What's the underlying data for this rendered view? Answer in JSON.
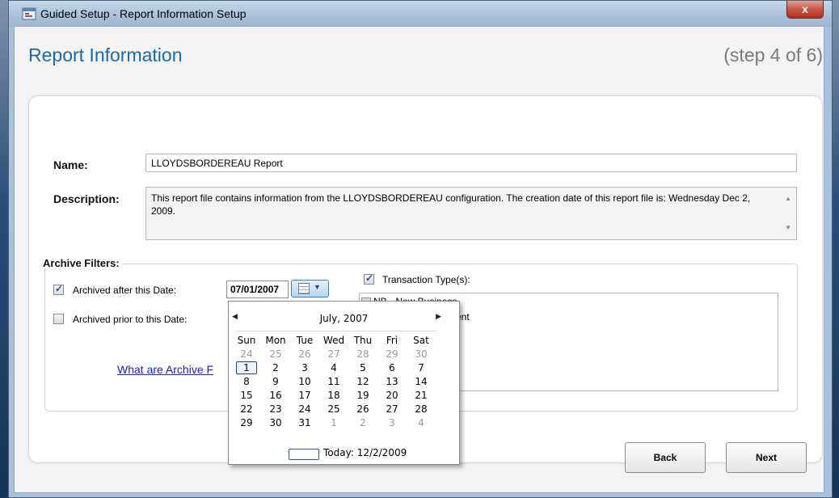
{
  "window": {
    "title": "Guided Setup - Report Information Setup",
    "close_label": "x"
  },
  "header": {
    "title": "Report Information",
    "step": "(step 4 of 6)"
  },
  "form": {
    "name_label": "Name:",
    "name_value": "LLOYDSBORDEREAU Report",
    "description_label": "Description:",
    "description_value": "This report file contains information from the LLOYDSBORDEREAU configuration.  The creation date of this report file is: Wednesday Dec 2, 2009."
  },
  "archive": {
    "section_label": "Archive Filters:",
    "after_label": "Archived after this Date:",
    "after_checked": true,
    "after_date": "07/01/2007",
    "prior_label": "Archived prior to this Date:",
    "prior_checked": false,
    "transaction_label": "Transaction Type(s):",
    "transaction_checked": true,
    "transaction_item1": "NB - New Business",
    "transaction_item2": "ent",
    "help_link": "What are Archive F"
  },
  "calendar": {
    "month": "July, 2007",
    "weekdays": [
      "Sun",
      "Mon",
      "Tue",
      "Wed",
      "Thu",
      "Fri",
      "Sat"
    ],
    "weeks": [
      [
        "24",
        "25",
        "26",
        "27",
        "28",
        "29",
        "30"
      ],
      [
        "1",
        "2",
        "3",
        "4",
        "5",
        "6",
        "7"
      ],
      [
        "8",
        "9",
        "10",
        "11",
        "12",
        "13",
        "14"
      ],
      [
        "15",
        "16",
        "17",
        "18",
        "19",
        "20",
        "21"
      ],
      [
        "22",
        "23",
        "24",
        "25",
        "26",
        "27",
        "28"
      ],
      [
        "29",
        "30",
        "31",
        "1",
        "2",
        "3",
        "4"
      ]
    ],
    "selected": "1",
    "today": "Today: 12/2/2009"
  },
  "buttons": {
    "back": "Back",
    "next": "Next"
  },
  "colors": {
    "title_blue": "#1a6aa8",
    "link_blue": "#1a1ae0",
    "close_red": "#c75443"
  }
}
